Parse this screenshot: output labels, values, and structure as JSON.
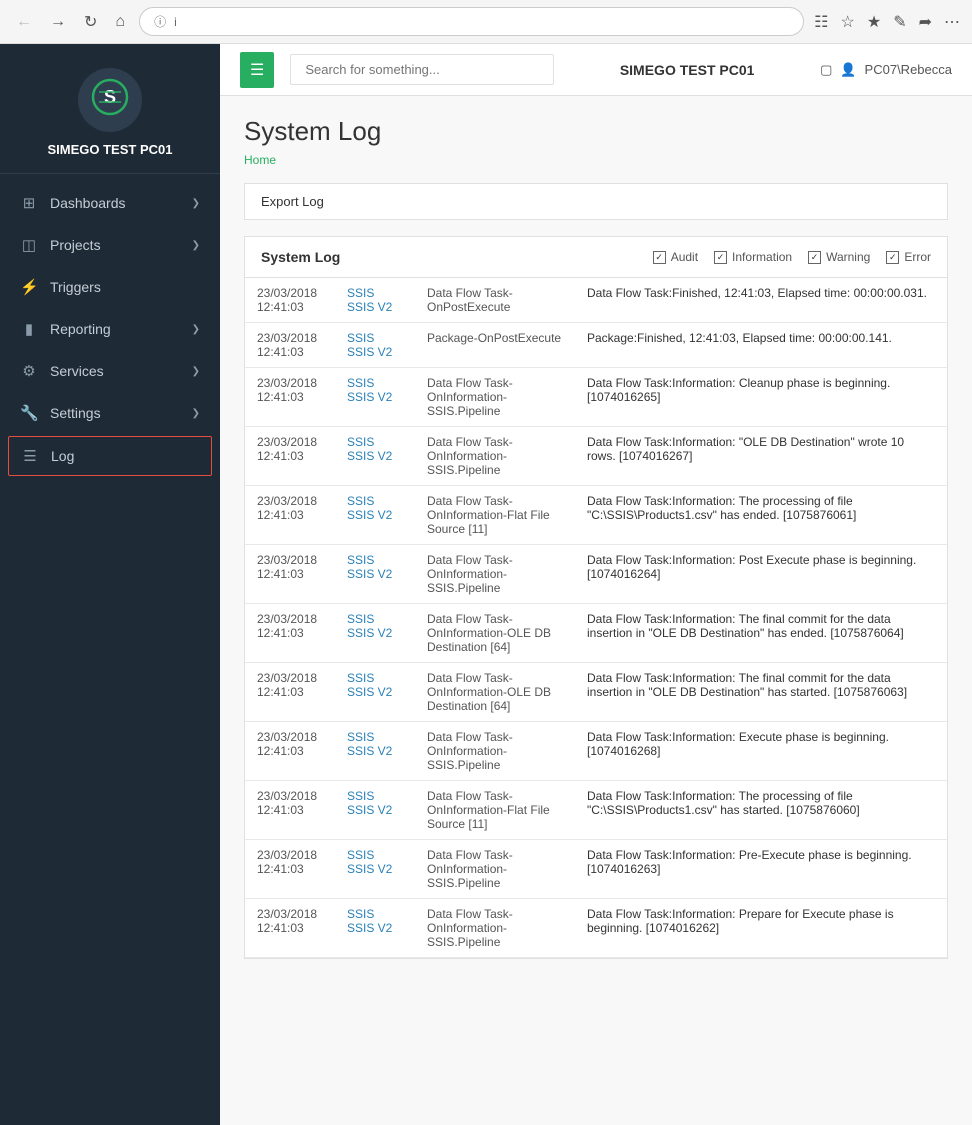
{
  "browser": {
    "address": "i"
  },
  "topbar": {
    "menu_icon": "☰",
    "search_placeholder": "Search for something...",
    "server_name": "SIMEGO TEST PC01",
    "user": "PC07\\Rebecca"
  },
  "sidebar": {
    "title": "SIMEGO TEST PC01",
    "nav_items": [
      {
        "id": "dashboards",
        "label": "Dashboards",
        "icon": "⊞",
        "has_arrow": true
      },
      {
        "id": "projects",
        "label": "Projects",
        "icon": "◫",
        "has_arrow": true
      },
      {
        "id": "triggers",
        "label": "Triggers",
        "icon": "⚡",
        "has_arrow": false
      },
      {
        "id": "reporting",
        "label": "Reporting",
        "icon": "📊",
        "has_arrow": true
      },
      {
        "id": "services",
        "label": "Services",
        "icon": "⚙",
        "has_arrow": true
      },
      {
        "id": "settings",
        "label": "Settings",
        "icon": "🔧",
        "has_arrow": true
      },
      {
        "id": "log",
        "label": "Log",
        "icon": "☰",
        "has_arrow": false,
        "active": true
      }
    ]
  },
  "page": {
    "title": "System Log",
    "breadcrumb": "Home",
    "export_label": "Export Log"
  },
  "log_panel": {
    "title": "System Log",
    "filters": [
      {
        "id": "audit",
        "label": "Audit",
        "checked": true
      },
      {
        "id": "information",
        "label": "Information",
        "checked": true
      },
      {
        "id": "warning",
        "label": "Warning",
        "checked": true
      },
      {
        "id": "error",
        "label": "Error",
        "checked": true
      }
    ]
  },
  "log_entries": [
    {
      "datetime": "23/03/2018 12:41:03",
      "source": "SSIS \\ SSIS V2",
      "task": "Data Flow Task-OnPostExecute",
      "message": "Data Flow Task:Finished, 12:41:03, Elapsed time: 00:00:00.031."
    },
    {
      "datetime": "23/03/2018 12:41:03",
      "source": "SSIS \\ SSIS V2",
      "task": "Package-OnPostExecute",
      "message": "Package:Finished, 12:41:03, Elapsed time: 00:00:00.141."
    },
    {
      "datetime": "23/03/2018 12:41:03",
      "source": "SSIS \\ SSIS V2",
      "task": "Data Flow Task-OnInformation-SSIS.Pipeline",
      "message": "Data Flow Task:Information: Cleanup phase is beginning. [1074016265]"
    },
    {
      "datetime": "23/03/2018 12:41:03",
      "source": "SSIS \\ SSIS V2",
      "task": "Data Flow Task-OnInformation-SSIS.Pipeline",
      "message": "Data Flow Task:Information: \"OLE DB Destination\" wrote 10 rows. [1074016267]"
    },
    {
      "datetime": "23/03/2018 12:41:03",
      "source": "SSIS \\ SSIS V2",
      "task": "Data Flow Task-OnInformation-Flat File Source [11]",
      "message": "Data Flow Task:Information: The processing of file \"C:\\SSIS\\Products1.csv\" has ended. [1075876061]"
    },
    {
      "datetime": "23/03/2018 12:41:03",
      "source": "SSIS \\ SSIS V2",
      "task": "Data Flow Task-OnInformation-SSIS.Pipeline",
      "message": "Data Flow Task:Information: Post Execute phase is beginning. [1074016264]"
    },
    {
      "datetime": "23/03/2018 12:41:03",
      "source": "SSIS \\ SSIS V2",
      "task": "Data Flow Task-OnInformation-OLE DB Destination [64]",
      "message": "Data Flow Task:Information: The final commit for the data insertion in \"OLE DB Destination\" has ended. [1075876064]"
    },
    {
      "datetime": "23/03/2018 12:41:03",
      "source": "SSIS \\ SSIS V2",
      "task": "Data Flow Task-OnInformation-OLE DB Destination [64]",
      "message": "Data Flow Task:Information: The final commit for the data insertion in \"OLE DB Destination\" has started. [1075876063]"
    },
    {
      "datetime": "23/03/2018 12:41:03",
      "source": "SSIS \\ SSIS V2",
      "task": "Data Flow Task-OnInformation-SSIS.Pipeline",
      "message": "Data Flow Task:Information: Execute phase is beginning. [1074016268]"
    },
    {
      "datetime": "23/03/2018 12:41:03",
      "source": "SSIS \\ SSIS V2",
      "task": "Data Flow Task-OnInformation-Flat File Source [11]",
      "message": "Data Flow Task:Information: The processing of file \"C:\\SSIS\\Products1.csv\" has started. [1075876060]"
    },
    {
      "datetime": "23/03/2018 12:41:03",
      "source": "SSIS \\ SSIS V2",
      "task": "Data Flow Task-OnInformation-SSIS.Pipeline",
      "message": "Data Flow Task:Information: Pre-Execute phase is beginning. [1074016263]"
    },
    {
      "datetime": "23/03/2018 12:41:03",
      "source": "SSIS \\ SSIS V2",
      "task": "Data Flow Task-OnInformation-SSIS.Pipeline",
      "message": "Data Flow Task:Information: Prepare for Execute phase is beginning. [1074016262]"
    }
  ]
}
